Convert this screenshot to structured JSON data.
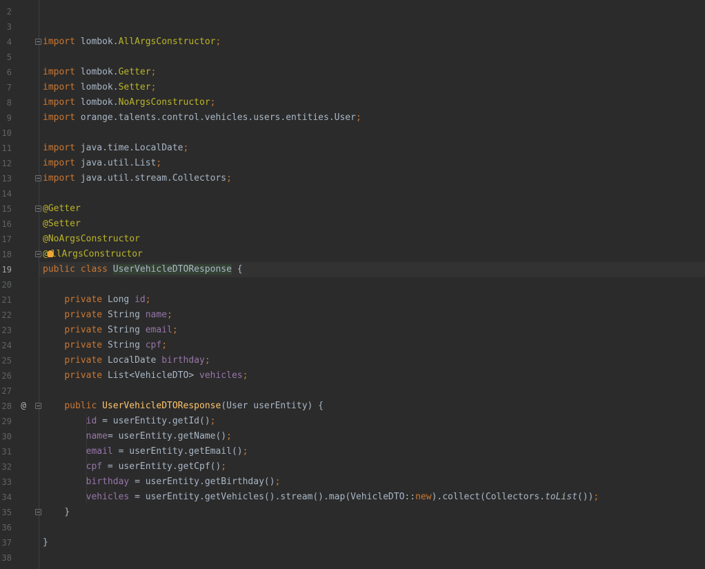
{
  "editor": {
    "file_language": "java",
    "current_line": 19,
    "lines": [
      {
        "n": "2"
      },
      {
        "n": "3"
      },
      {
        "n": "4"
      },
      {
        "n": "5"
      },
      {
        "n": "6"
      },
      {
        "n": "7"
      },
      {
        "n": "8"
      },
      {
        "n": "9"
      },
      {
        "n": "10"
      },
      {
        "n": "11"
      },
      {
        "n": "12"
      },
      {
        "n": "13"
      },
      {
        "n": "14"
      },
      {
        "n": "15"
      },
      {
        "n": "16"
      },
      {
        "n": "17"
      },
      {
        "n": "18"
      },
      {
        "n": "19"
      },
      {
        "n": "20"
      },
      {
        "n": "21"
      },
      {
        "n": "22"
      },
      {
        "n": "23"
      },
      {
        "n": "24"
      },
      {
        "n": "25"
      },
      {
        "n": "26"
      },
      {
        "n": "27"
      },
      {
        "n": "28"
      },
      {
        "n": "29"
      },
      {
        "n": "30"
      },
      {
        "n": "31"
      },
      {
        "n": "32"
      },
      {
        "n": "33"
      },
      {
        "n": "34"
      },
      {
        "n": "35"
      },
      {
        "n": "36"
      },
      {
        "n": "37"
      },
      {
        "n": "38"
      }
    ],
    "code": {
      "l4": {
        "kw": "import ",
        "pkg": "lombok.",
        "cls": "AllArgsConstructor",
        "semi": ";"
      },
      "l6": {
        "kw": "import ",
        "pkg": "lombok.",
        "cls": "Getter",
        "semi": ";"
      },
      "l7": {
        "kw": "import ",
        "pkg": "lombok.",
        "cls": "Setter",
        "semi": ";"
      },
      "l8": {
        "kw": "import ",
        "pkg": "lombok.",
        "cls": "NoArgsConstructor",
        "semi": ";"
      },
      "l9": {
        "kw": "import ",
        "pkg": "orange.talents.control.vehicles.users.entities.User",
        "semi": ";"
      },
      "l11": {
        "kw": "import ",
        "pkg": "java.time.LocalDate",
        "semi": ";"
      },
      "l12": {
        "kw": "import ",
        "pkg": "java.util.List",
        "semi": ";"
      },
      "l13": {
        "kw": "import ",
        "pkg": "java.util.stream.Collectors",
        "semi": ";"
      },
      "l15": {
        "ann": "@Getter"
      },
      "l16": {
        "ann": "@Setter"
      },
      "l17": {
        "ann": "@NoArgsConstructor"
      },
      "l18": {
        "ann_a": "@",
        "ann_b": "llArgsConstructor"
      },
      "l19": {
        "kw": "public class ",
        "cls": "UserVehicleDTOResponse",
        "rest": " {"
      },
      "l21": {
        "kw": "private ",
        "type": "Long ",
        "fld": "id",
        "semi": ";"
      },
      "l22": {
        "kw": "private ",
        "type": "String ",
        "fld": "name",
        "semi": ";"
      },
      "l23": {
        "kw": "private ",
        "type": "String ",
        "fld": "email",
        "semi": ";"
      },
      "l24": {
        "kw": "private ",
        "type": "String ",
        "fld": "cpf",
        "semi": ";"
      },
      "l25": {
        "kw": "private ",
        "type": "LocalDate ",
        "fld": "birthday",
        "semi": ";"
      },
      "l26": {
        "kw": "private ",
        "type": "List<VehicleDTO> ",
        "fld": "vehicles",
        "semi": ";"
      },
      "l28": {
        "kw": "public ",
        "method": "UserVehicleDTOResponse",
        "rest": "(User userEntity) {"
      },
      "l29": {
        "fld": "id",
        "rest": " = userEntity.getId()",
        "semi": ";"
      },
      "l30": {
        "fld": "name",
        "rest": "= userEntity.getName()",
        "semi": ";"
      },
      "l31": {
        "fld": "email",
        "rest": " = userEntity.getEmail()",
        "semi": ";"
      },
      "l32": {
        "fld": "cpf",
        "rest": " = userEntity.getCpf()",
        "semi": ";"
      },
      "l33": {
        "fld": "birthday",
        "rest": " = userEntity.getBirthday()",
        "semi": ";"
      },
      "l34": {
        "fld": "vehicles",
        "a": " = userEntity.getVehicles().stream().map(VehicleDTO::",
        "kw": "new",
        "b": ").collect(Collectors.",
        "it": "toList",
        "c": "())",
        "semi": ";"
      },
      "l35": {
        "rest": "}"
      },
      "l37": {
        "rest": "}"
      }
    }
  }
}
